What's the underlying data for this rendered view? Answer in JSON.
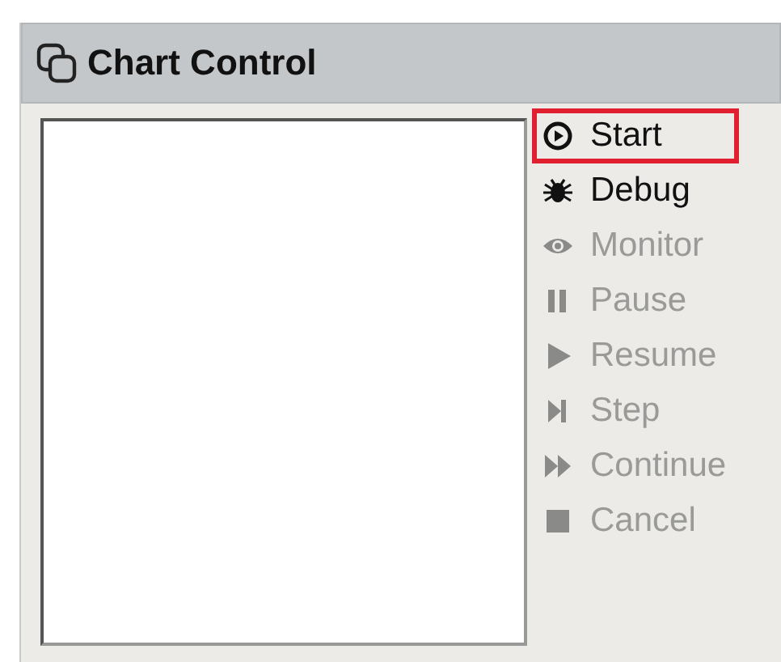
{
  "panel": {
    "title": "Chart Control"
  },
  "actions": [
    {
      "label": "Start",
      "disabled": false,
      "highlighted": true
    },
    {
      "label": "Debug",
      "disabled": false,
      "highlighted": false
    },
    {
      "label": "Monitor",
      "disabled": true,
      "highlighted": false
    },
    {
      "label": "Pause",
      "disabled": true,
      "highlighted": false
    },
    {
      "label": "Resume",
      "disabled": true,
      "highlighted": false
    },
    {
      "label": "Step",
      "disabled": true,
      "highlighted": false
    },
    {
      "label": "Continue",
      "disabled": true,
      "highlighted": false
    },
    {
      "label": "Cancel",
      "disabled": true,
      "highlighted": false
    }
  ]
}
